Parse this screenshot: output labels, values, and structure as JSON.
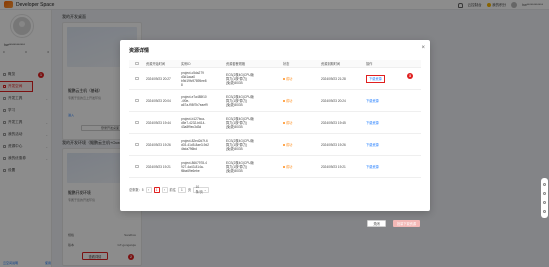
{
  "app": {
    "title": "Developer Space",
    "top_right": {
      "console": "云控制台",
      "coin_label": "我的积分",
      "user": "hw************"
    }
  },
  "sidebar": {
    "profile_name": "hw************",
    "stats": [
      "0",
      "0",
      "0"
    ],
    "items": [
      {
        "label": "概览",
        "active": false
      },
      {
        "label": "开发空间",
        "active": true
      },
      {
        "label": "开发工具",
        "active": false
      },
      {
        "label": "学习",
        "active": false
      },
      {
        "label": "开发工具",
        "active": false
      },
      {
        "label": "我的活动",
        "active": false
      },
      {
        "label": "资源中心",
        "active": false
      },
      {
        "label": "我的优惠券",
        "active": false
      },
      {
        "label": "设置",
        "active": false
      }
    ],
    "footer_left": "云空间说明",
    "footer_right": "使用"
  },
  "main": {
    "section_title": "我的开发桌面",
    "card1": {
      "title": "鲲鹏云主机（基础）",
      "subtitle": "专属于您的云上开发环境",
      "link": "进入",
      "button": "登录开发桌面"
    },
    "card2": {
      "title": "鲲鹏开发环境（基础）",
      "subtitle": "专属于您的开发环境",
      "kv": [
        {
          "k": "规格",
          "v": "Sandbox"
        },
        {
          "k": "版本",
          "v": "GT-gongwujie"
        }
      ],
      "detail_button": "查看详情"
    },
    "section2_title": "我的开发环境（鲲鹏云主机+OceanStor）",
    "card3_title": "鲲鹏开发环境"
  },
  "annotations": {
    "sidebar_badge": "1",
    "detail_badge": "2",
    "op_badge": "3"
  },
  "modal": {
    "title": "资源详情",
    "close_glyph": "×",
    "headers": [
      "",
      "资源开始时间",
      "实例ID",
      "资源套餐规格",
      "状态",
      "资源到期时间",
      "操作"
    ],
    "rows": [
      {
        "start": "2024/09/23 20:27",
        "instance": "project-c5da279\nd3d1aca0\nb9d19fc97895ee8\n8",
        "spec": "ECS(2核4G)CPU版\n算力(1核*算力)\n(免费)50GB",
        "status": "成功",
        "expire": "2024/09/23 21:28",
        "op": "下载资源",
        "highlight": true
      },
      {
        "start": "2024/09/23 20:04",
        "instance": "project-e7a485f10\n-4f0e-\na67a-f98f7b7eaef9",
        "spec": "ECS(2核4G)CPU版\n算力(1核*算力)\n(免费)50GB",
        "status": "成功",
        "expire": "2024/09/23 20:24",
        "op": "下载资源",
        "highlight": false
      },
      {
        "start": "2024/09/23 19:44",
        "instance": "project-b127bca-\nd5e7-4232-b614-\n43a8f9ec3d3d",
        "spec": "ECS(2核4G)CPU版\n算力(1核*算力)\n(免费)50GB",
        "status": "成功",
        "expire": "2024/09/23 19:45",
        "op": "下载资源",
        "highlight": false
      },
      {
        "start": "2024/09/23 19:26",
        "instance": "project-82ed2d7f-6\nd03-41d5-8ae3-9d2\n4bda796bd",
        "spec": "ECS(2核4G)CPU版\n算力(1核*算力)\n(免费)50GB",
        "status": "成功",
        "expire": "2024/09/23 19:26",
        "op": "下载资源",
        "highlight": false
      },
      {
        "start": "2024/09/23 19:21",
        "instance": "project-8667978-4\n927-4a43-814a-\nf8ba69e6ebe",
        "spec": "ECS(2核4G)CPU版\n算力(1核*算力)\n(免费)50GB",
        "status": "成功",
        "expire": "2024/09/23 19:21",
        "op": "下载资源",
        "highlight": false
      }
    ],
    "pager": {
      "total_label": "总条数：5",
      "prev": "‹",
      "current": "1",
      "next": "›",
      "goto_label": "前往",
      "goto_value": "1",
      "page_unit": "页",
      "page_size": "10 条/页"
    },
    "cancel": "关闭",
    "confirm": "批量下载资源"
  }
}
